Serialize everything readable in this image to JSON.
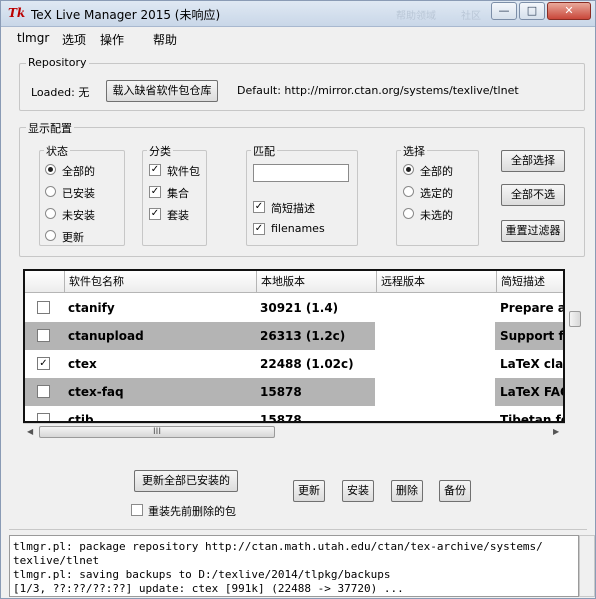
{
  "window": {
    "title": "TeX Live Manager 2015 (未响应)",
    "title_icon": "Tk",
    "ghost_caption_1": "帮助领域",
    "ghost_caption_2": "社区",
    "controls": {
      "minimize": "—",
      "maximize": "□",
      "close": "✕"
    }
  },
  "menu": [
    {
      "label": "tlmgr"
    },
    {
      "label": "选项"
    },
    {
      "label": "操作"
    },
    {
      "label": "帮助"
    }
  ],
  "repository": {
    "legend": "Repository",
    "loaded_label": "Loaded: 无",
    "load_default_button": "载入缺省软件包仓库",
    "default_text": "Default: http://mirror.ctan.org/systems/texlive/tlnet"
  },
  "display": {
    "legend": "显示配置",
    "status": {
      "legend": "状态",
      "options": [
        {
          "label": "全部的",
          "selected": true
        },
        {
          "label": "已安装",
          "selected": false
        },
        {
          "label": "未安装",
          "selected": false
        },
        {
          "label": "更新",
          "selected": false
        }
      ]
    },
    "category": {
      "legend": "分类",
      "options": [
        {
          "label": "软件包",
          "checked": true
        },
        {
          "label": "集合",
          "checked": true
        },
        {
          "label": "套装",
          "checked": true
        }
      ]
    },
    "match": {
      "legend": "匹配",
      "search_value": "",
      "options": [
        {
          "label": "简短描述",
          "checked": true
        },
        {
          "label": "filenames",
          "checked": true
        }
      ]
    },
    "select": {
      "legend": "选择",
      "options": [
        {
          "label": "全部的",
          "selected": true
        },
        {
          "label": "选定的",
          "selected": false
        },
        {
          "label": "未选的",
          "selected": false
        }
      ]
    },
    "buttons": {
      "select_all": "全部选择",
      "deselect_all": "全部不选",
      "reset_filters": "重置过滤器"
    }
  },
  "table": {
    "headers": [
      "",
      "软件包名称",
      "本地版本",
      "远程版本",
      "简短描述"
    ],
    "rows": [
      {
        "checked": false,
        "name": "ctanify",
        "local": "30921 (1.4)",
        "remote": "",
        "desc": "Prepare a p"
      },
      {
        "checked": false,
        "name": "ctanupload",
        "local": "26313 (1.2c)",
        "remote": "",
        "desc": "Support for"
      },
      {
        "checked": true,
        "name": "ctex",
        "local": "22488 (1.02c)",
        "remote": "",
        "desc": "LaTeX class"
      },
      {
        "checked": false,
        "name": "ctex-faq",
        "local": "15878",
        "remote": "",
        "desc": "LaTeX FAQ"
      },
      {
        "checked": false,
        "name": "ctib",
        "local": "15878",
        "remote": "",
        "desc": "Tibetan for"
      }
    ],
    "hscroll_thumb": "III"
  },
  "actions": {
    "update_all": "更新全部已安装的",
    "reinstall_removed": "重装先前删除的包",
    "update": "更新",
    "install": "安装",
    "remove": "删除",
    "backup": "备份"
  },
  "log": {
    "lines": [
      "tlmgr.pl: package repository http://ctan.math.utah.edu/ctan/tex-archive/systems/",
      "texlive/tlnet",
      "tlmgr.pl: saving backups to D:/texlive/2014/tlpkg/backups",
      "[1/3, ??:??/??:??] update: ctex [991k] (22488 -> 37720) ..."
    ]
  }
}
